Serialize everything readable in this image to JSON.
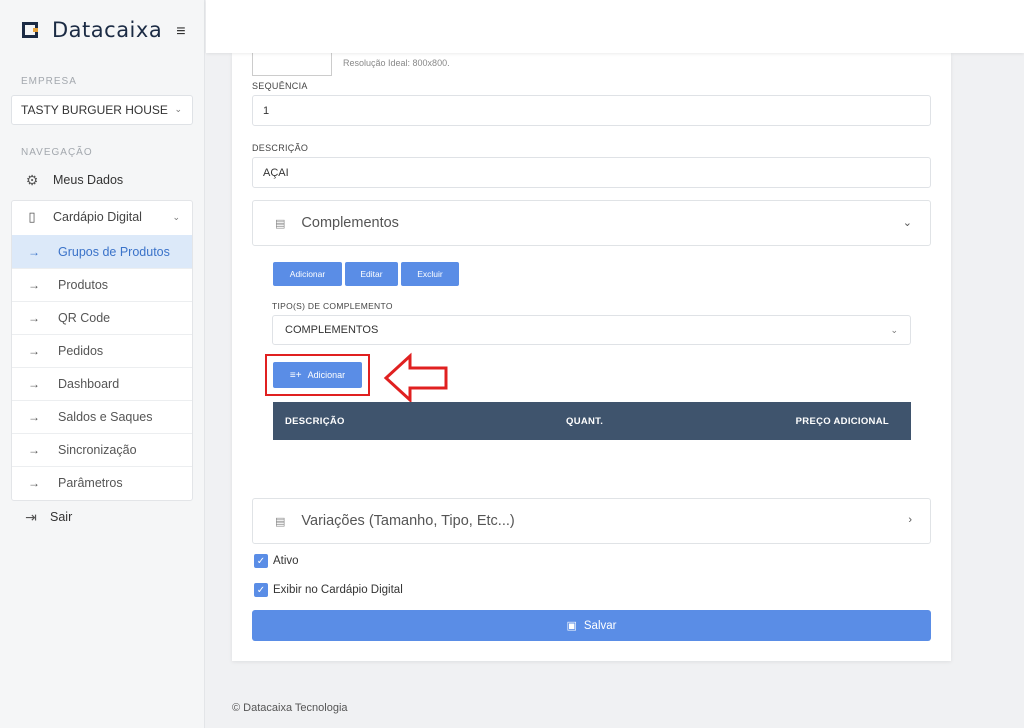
{
  "brand": {
    "name": "Datacaixa"
  },
  "sidebar": {
    "empresa_label": "EMPRESA",
    "company": "TASTY BURGUER HOUSE",
    "navegacao_label": "NAVEGAÇÃO",
    "meus_dados": "Meus Dados",
    "cardapio": "Cardápio Digital",
    "sub_items": [
      {
        "label": "Grupos de Produtos"
      },
      {
        "label": "Produtos"
      },
      {
        "label": "QR Code"
      },
      {
        "label": "Pedidos"
      },
      {
        "label": "Dashboard"
      },
      {
        "label": "Saldos e Saques"
      },
      {
        "label": "Sincronização"
      },
      {
        "label": "Parâmetros"
      }
    ],
    "sair": "Sair"
  },
  "form": {
    "resolution_hint": "Resolução Ideal: 800x800.",
    "sequencia_label": "SEQUÊNCIA",
    "sequencia_value": "1",
    "descricao_label": "DESCRIÇÃO",
    "descricao_value": "AÇAI",
    "complementos_title": "Complementos",
    "btn_adicionar": "Adicionar",
    "btn_editar": "Editar",
    "btn_excluir": "Excluir",
    "tipo_label": "TIPO(S) DE COMPLEMENTO",
    "tipo_value": "COMPLEMENTOS",
    "btn_add_item": "Adicionar",
    "table_headers": {
      "descricao": "DESCRIÇÃO",
      "quant": "QUANT.",
      "preco": "PREÇO ADICIONAL"
    },
    "variacoes_title": "Variações (Tamanho, Tipo, Etc...)",
    "ativo": "Ativo",
    "exibir": "Exibir no Cardápio Digital",
    "salvar": "Salvar"
  },
  "footer": "© Datacaixa Tecnologia",
  "colors": {
    "accent": "#5a8de6",
    "table_header": "#3f546d",
    "highlight": "#e02020"
  },
  "icons": [
    "hamburger-icon",
    "gear-icon",
    "phone-icon",
    "arrow-right-icon",
    "logout-icon",
    "list-icon",
    "chevron-down-icon",
    "chevron-right-icon",
    "check-icon",
    "save-icon"
  ]
}
